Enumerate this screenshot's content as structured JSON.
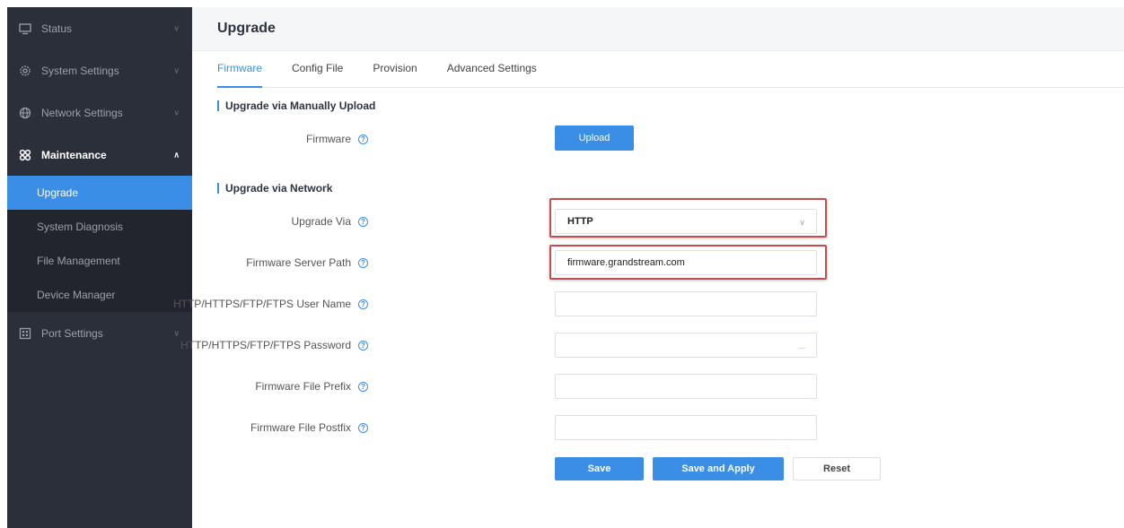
{
  "sidebar": {
    "items": [
      {
        "label": "Status",
        "icon": "monitor-icon"
      },
      {
        "label": "System Settings",
        "icon": "gear-icon"
      },
      {
        "label": "Network Settings",
        "icon": "globe-icon"
      },
      {
        "label": "Maintenance",
        "icon": "grid-icon"
      },
      {
        "label": "Port Settings",
        "icon": "port-icon"
      }
    ],
    "submenu": [
      "Upgrade",
      "System Diagnosis",
      "File Management",
      "Device Manager"
    ]
  },
  "header": {
    "title": "Upgrade"
  },
  "tabs": [
    "Firmware",
    "Config File",
    "Provision",
    "Advanced Settings"
  ],
  "sections": {
    "manual": "Upgrade via Manually Upload",
    "network": "Upgrade via Network"
  },
  "form": {
    "firmware_label": "Firmware",
    "upload_button": "Upload",
    "upgrade_via_label": "Upgrade Via",
    "upgrade_via_value": "HTTP",
    "server_path_label": "Firmware Server Path",
    "server_path_value": "firmware.grandstream.com",
    "username_label": "HTTP/HTTPS/FTP/FTPS User Name",
    "username_value": "",
    "password_label": "HTTP/HTTPS/FTP/FTPS Password",
    "password_value": "",
    "prefix_label": "Firmware File Prefix",
    "prefix_value": "",
    "postfix_label": "Firmware File Postfix",
    "postfix_value": ""
  },
  "buttons": {
    "save": "Save",
    "save_apply": "Save and Apply",
    "reset": "Reset"
  },
  "colors": {
    "accent": "#3a8ee6",
    "sidebar_bg": "#2b2f3a",
    "highlight": "#c0504d"
  }
}
